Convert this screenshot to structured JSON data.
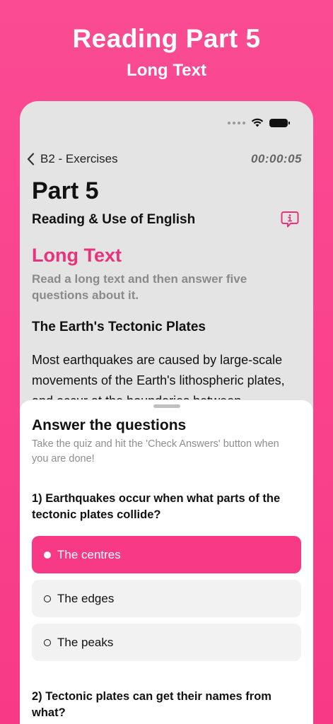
{
  "promo": {
    "title": "Reading Part 5",
    "subtitle": "Long Text"
  },
  "nav": {
    "back_label": "B2 - Exercises",
    "timer": "00:00:05"
  },
  "header": {
    "part_title": "Part 5",
    "section_name": "Reading & Use of English"
  },
  "task": {
    "title": "Long Text",
    "description": "Read a long text and then answer five questions about it."
  },
  "text": {
    "title": "The Earth's Tectonic Plates",
    "body": "Most earthquakes are caused by large-scale movements of the Earth's lithospheric plates, and occur at the boundaries between"
  },
  "sheet": {
    "title": "Answer the questions",
    "subtitle": "Take the quiz and hit the 'Check Answers' button when you are done!"
  },
  "questions": [
    {
      "text": "1) Earthquakes occur when what parts of the tectonic plates collide?",
      "options": [
        "The centres",
        "The edges",
        "The peaks"
      ],
      "selected": "The centres"
    },
    {
      "text": "2) Tectonic plates can get their names from what?"
    }
  ],
  "colors": {
    "brand": "#f83a86",
    "accent_text": "#e8327c"
  },
  "icons": {
    "back": "chevron-left-icon",
    "info": "info-bubble-icon",
    "wifi": "wifi-icon",
    "battery": "battery-icon",
    "radio_selected": "filled-circle-icon",
    "radio_unselected": "empty-circle-icon"
  }
}
